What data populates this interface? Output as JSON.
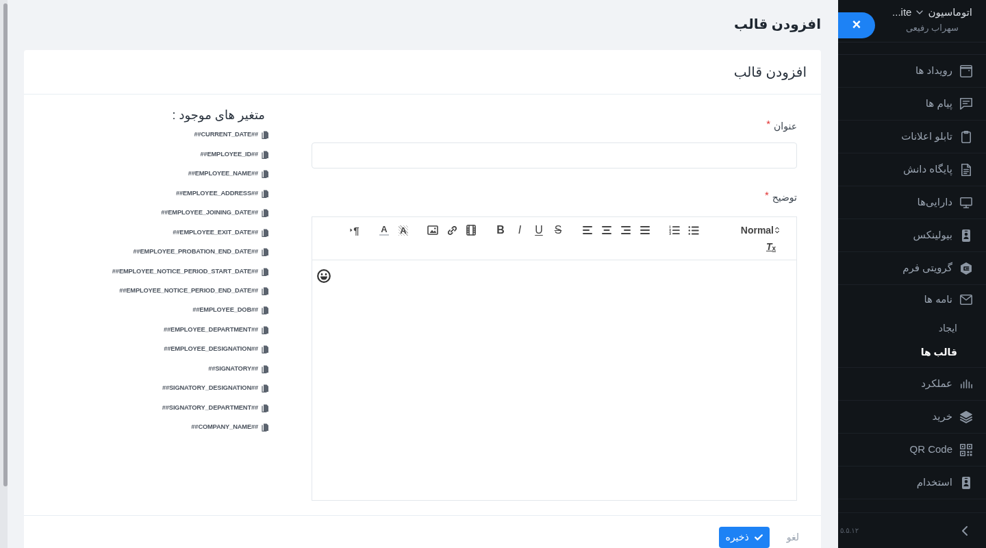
{
  "sidebar": {
    "workspace": {
      "title": "اتوماسیون",
      "dropdown_text": "...ite",
      "subtitle": "سهراب رفیعی"
    },
    "items": [
      {
        "label": "رویداد ها",
        "selected": false
      },
      {
        "label": "پیام ها",
        "selected": false
      },
      {
        "label": "تابلو اعلانات",
        "selected": false
      },
      {
        "label": "پایگاه دانش",
        "selected": false
      },
      {
        "label": "دارایی‌ها",
        "selected": false
      },
      {
        "label": "بیولینکس",
        "selected": false
      },
      {
        "label": "گرویتی فرم",
        "selected": false
      },
      {
        "label": "نامه ها",
        "selected": false,
        "children": [
          {
            "label": "ایجاد",
            "selected": false
          },
          {
            "label": "قالب ها",
            "selected": true
          }
        ]
      },
      {
        "label": "عملکرد",
        "selected": false
      },
      {
        "label": "خرید",
        "selected": false
      },
      {
        "label": "QR Code",
        "selected": false
      },
      {
        "label": "استخدام",
        "selected": false
      }
    ],
    "version": "۵.۵.۱۲"
  },
  "drawer": {
    "close_button": "×",
    "title": "افزودن قالب",
    "card": {
      "title": "افزودن قالب",
      "fields": [
        {
          "kind": "text",
          "label": "عنوان",
          "required_mark": "*"
        },
        {
          "kind": "editor",
          "label": "توضیح",
          "required_mark": "*",
          "toolbar": {
            "heading_picker": "Normal",
            "format_buttons": [
              {
                "kind": "strike",
                "label": "S"
              },
              {
                "kind": "underline",
                "label": "U"
              },
              {
                "kind": "italic",
                "label": "I"
              },
              {
                "kind": "bold",
                "label": "B"
              }
            ],
            "color_buttons": [
              {
                "kind": "background",
                "label": "A"
              },
              {
                "kind": "color",
                "label": "A"
              }
            ],
            "direction_button": "¶",
            "clean_button": "T$_{x}$"
          }
        }
      ],
      "variables": {
        "heading": "متغیر های موجود :",
        "items": [
          "##CURRENT_DATE##",
          "##EMPLOYEE_ID##",
          "##EMPLOYEE_NAME##",
          "##EMPLOYEE_ADDRESS##",
          "##EMPLOYEE_JOINING_DATE##",
          "##EMPLOYEE_EXIT_DATE##",
          "##EMPLOYEE_PROBATION_END_DATE##",
          "##EMPLOYEE_NOTICE_PERIOD_START_DATE##",
          "##EMPLOYEE_NOTICE_PERIOD_END_DATE##",
          "##EMPLOYEE_DOB##",
          "##EMPLOYEE_DEPARTMENT##",
          "##EMPLOYEE_DESIGNATION##",
          "##SIGNATORY##",
          "##SIGNATORY_DESIGNATION##",
          "##SIGNATORY_DEPARTMENT##",
          "##COMPANY_NAME##"
        ]
      },
      "actions": {
        "cancel": "لغو",
        "save": "ذخیره"
      }
    }
  }
}
